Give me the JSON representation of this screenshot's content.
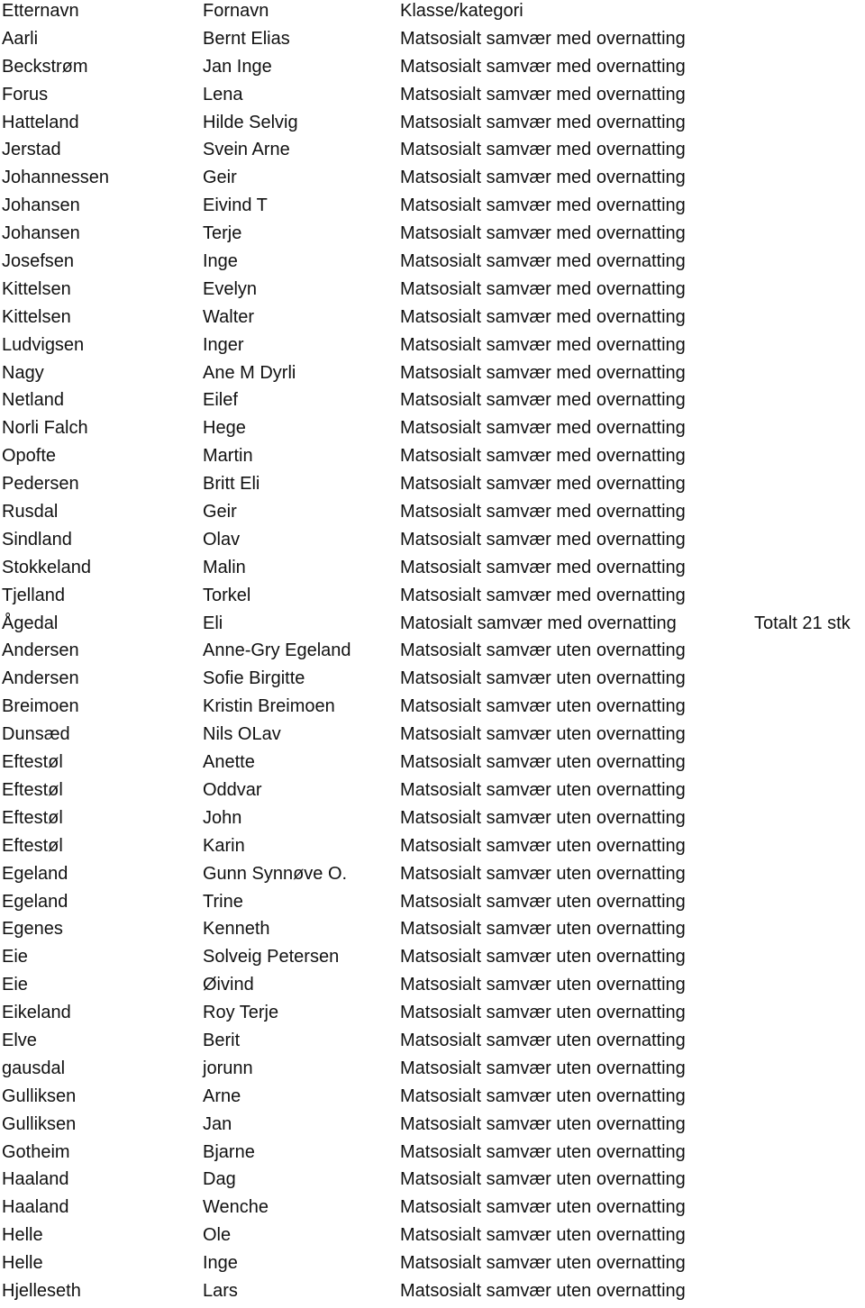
{
  "headers": {
    "last_name": "Etternavn",
    "first_name": "Fornavn",
    "category": "Klasse/kategori"
  },
  "rows": [
    {
      "last": "Aarli",
      "first": "Bernt Elias",
      "category": "Matsosialt samvær med overnatting",
      "note": ""
    },
    {
      "last": "Beckstrøm",
      "first": "Jan Inge",
      "category": "Matsosialt samvær med overnatting",
      "note": ""
    },
    {
      "last": "Forus",
      "first": "Lena",
      "category": "Matsosialt samvær med overnatting",
      "note": ""
    },
    {
      "last": "Hatteland",
      "first": "Hilde Selvig",
      "category": "Matsosialt samvær med overnatting",
      "note": ""
    },
    {
      "last": "Jerstad",
      "first": "Svein Arne",
      "category": "Matsosialt samvær med overnatting",
      "note": ""
    },
    {
      "last": "Johannessen",
      "first": "Geir",
      "category": "Matsosialt samvær med overnatting",
      "note": ""
    },
    {
      "last": "Johansen",
      "first": "Eivind T",
      "category": "Matsosialt samvær med overnatting",
      "note": ""
    },
    {
      "last": "Johansen",
      "first": "Terje",
      "category": "Matsosialt samvær med overnatting",
      "note": ""
    },
    {
      "last": "Josefsen",
      "first": "Inge",
      "category": "Matsosialt samvær med overnatting",
      "note": ""
    },
    {
      "last": "Kittelsen",
      "first": "Evelyn",
      "category": "Matsosialt samvær med overnatting",
      "note": ""
    },
    {
      "last": "Kittelsen",
      "first": "Walter",
      "category": "Matsosialt samvær med overnatting",
      "note": ""
    },
    {
      "last": "Ludvigsen",
      "first": "Inger",
      "category": "Matsosialt samvær med overnatting",
      "note": ""
    },
    {
      "last": "Nagy",
      "first": "Ane M Dyrli",
      "category": "Matsosialt samvær med overnatting",
      "note": ""
    },
    {
      "last": "Netland",
      "first": "Eilef",
      "category": "Matsosialt samvær med overnatting",
      "note": ""
    },
    {
      "last": "Norli Falch",
      "first": "Hege",
      "category": "Matsosialt samvær med overnatting",
      "note": ""
    },
    {
      "last": "Opofte",
      "first": "Martin",
      "category": "Matsosialt samvær med overnatting",
      "note": ""
    },
    {
      "last": "Pedersen",
      "first": "Britt Eli",
      "category": "Matsosialt samvær med overnatting",
      "note": ""
    },
    {
      "last": "Rusdal",
      "first": "Geir",
      "category": "Matsosialt samvær med overnatting",
      "note": ""
    },
    {
      "last": "Sindland",
      "first": "Olav",
      "category": "Matsosialt samvær med overnatting",
      "note": ""
    },
    {
      "last": "Stokkeland",
      "first": "Malin",
      "category": "Matsosialt samvær med overnatting",
      "note": ""
    },
    {
      "last": "Tjelland",
      "first": "Torkel",
      "category": "Matsosialt samvær med overnatting",
      "note": ""
    },
    {
      "last": "Ågedal",
      "first": "Eli",
      "category": "Matosialt samvær med overnatting",
      "note": "Totalt 21 stk"
    },
    {
      "last": "Andersen",
      "first": "Anne-Gry Egeland",
      "category": "Matsosialt samvær uten overnatting",
      "note": ""
    },
    {
      "last": "Andersen",
      "first": "Sofie Birgitte",
      "category": "Matsosialt samvær uten overnatting",
      "note": ""
    },
    {
      "last": "Breimoen",
      "first": "Kristin Breimoen",
      "category": "Matsosialt samvær uten overnatting",
      "note": ""
    },
    {
      "last": "Dunsæd",
      "first": "Nils OLav",
      "category": "Matsosialt samvær uten overnatting",
      "note": ""
    },
    {
      "last": "Eftestøl",
      "first": "Anette",
      "category": "Matsosialt samvær uten overnatting",
      "note": ""
    },
    {
      "last": "Eftestøl",
      "first": "Oddvar",
      "category": "Matsosialt samvær uten overnatting",
      "note": ""
    },
    {
      "last": "Eftestøl",
      "first": "John",
      "category": "Matsosialt samvær uten overnatting",
      "note": ""
    },
    {
      "last": "Eftestøl",
      "first": "Karin",
      "category": "Matsosialt samvær uten overnatting",
      "note": ""
    },
    {
      "last": "Egeland",
      "first": "Gunn Synnøve O.",
      "category": "Matsosialt samvær uten overnatting",
      "note": ""
    },
    {
      "last": "Egeland",
      "first": "Trine",
      "category": "Matsosialt samvær uten overnatting",
      "note": ""
    },
    {
      "last": "Egenes",
      "first": "Kenneth",
      "category": "Matsosialt samvær uten overnatting",
      "note": ""
    },
    {
      "last": "Eie",
      "first": "Solveig Petersen",
      "category": "Matsosialt samvær uten overnatting",
      "note": ""
    },
    {
      "last": "Eie",
      "first": "Øivind",
      "category": "Matsosialt samvær uten overnatting",
      "note": ""
    },
    {
      "last": "Eikeland",
      "first": "Roy Terje",
      "category": "Matsosialt samvær uten overnatting",
      "note": ""
    },
    {
      "last": "Elve",
      "first": "Berit",
      "category": "Matsosialt samvær uten overnatting",
      "note": ""
    },
    {
      "last": "gausdal",
      "first": "jorunn",
      "category": "Matsosialt samvær uten overnatting",
      "note": ""
    },
    {
      "last": "Gulliksen",
      "first": "Arne",
      "category": "Matsosialt samvær uten overnatting",
      "note": ""
    },
    {
      "last": "Gulliksen",
      "first": "Jan",
      "category": "Matsosialt samvær uten overnatting",
      "note": ""
    },
    {
      "last": "Gotheim",
      "first": "Bjarne",
      "category": "Matsosialt samvær uten overnatting",
      "note": ""
    },
    {
      "last": "Haaland",
      "first": "Dag",
      "category": "Matsosialt samvær uten overnatting",
      "note": ""
    },
    {
      "last": "Haaland",
      "first": "Wenche",
      "category": "Matsosialt samvær uten overnatting",
      "note": ""
    },
    {
      "last": "Helle",
      "first": "Ole",
      "category": "Matsosialt samvær uten overnatting",
      "note": ""
    },
    {
      "last": "Helle",
      "first": "Inge",
      "category": "Matsosialt samvær uten overnatting",
      "note": ""
    },
    {
      "last": "Hjelleseth",
      "first": "Lars",
      "category": "Matsosialt samvær uten overnatting",
      "note": ""
    }
  ]
}
